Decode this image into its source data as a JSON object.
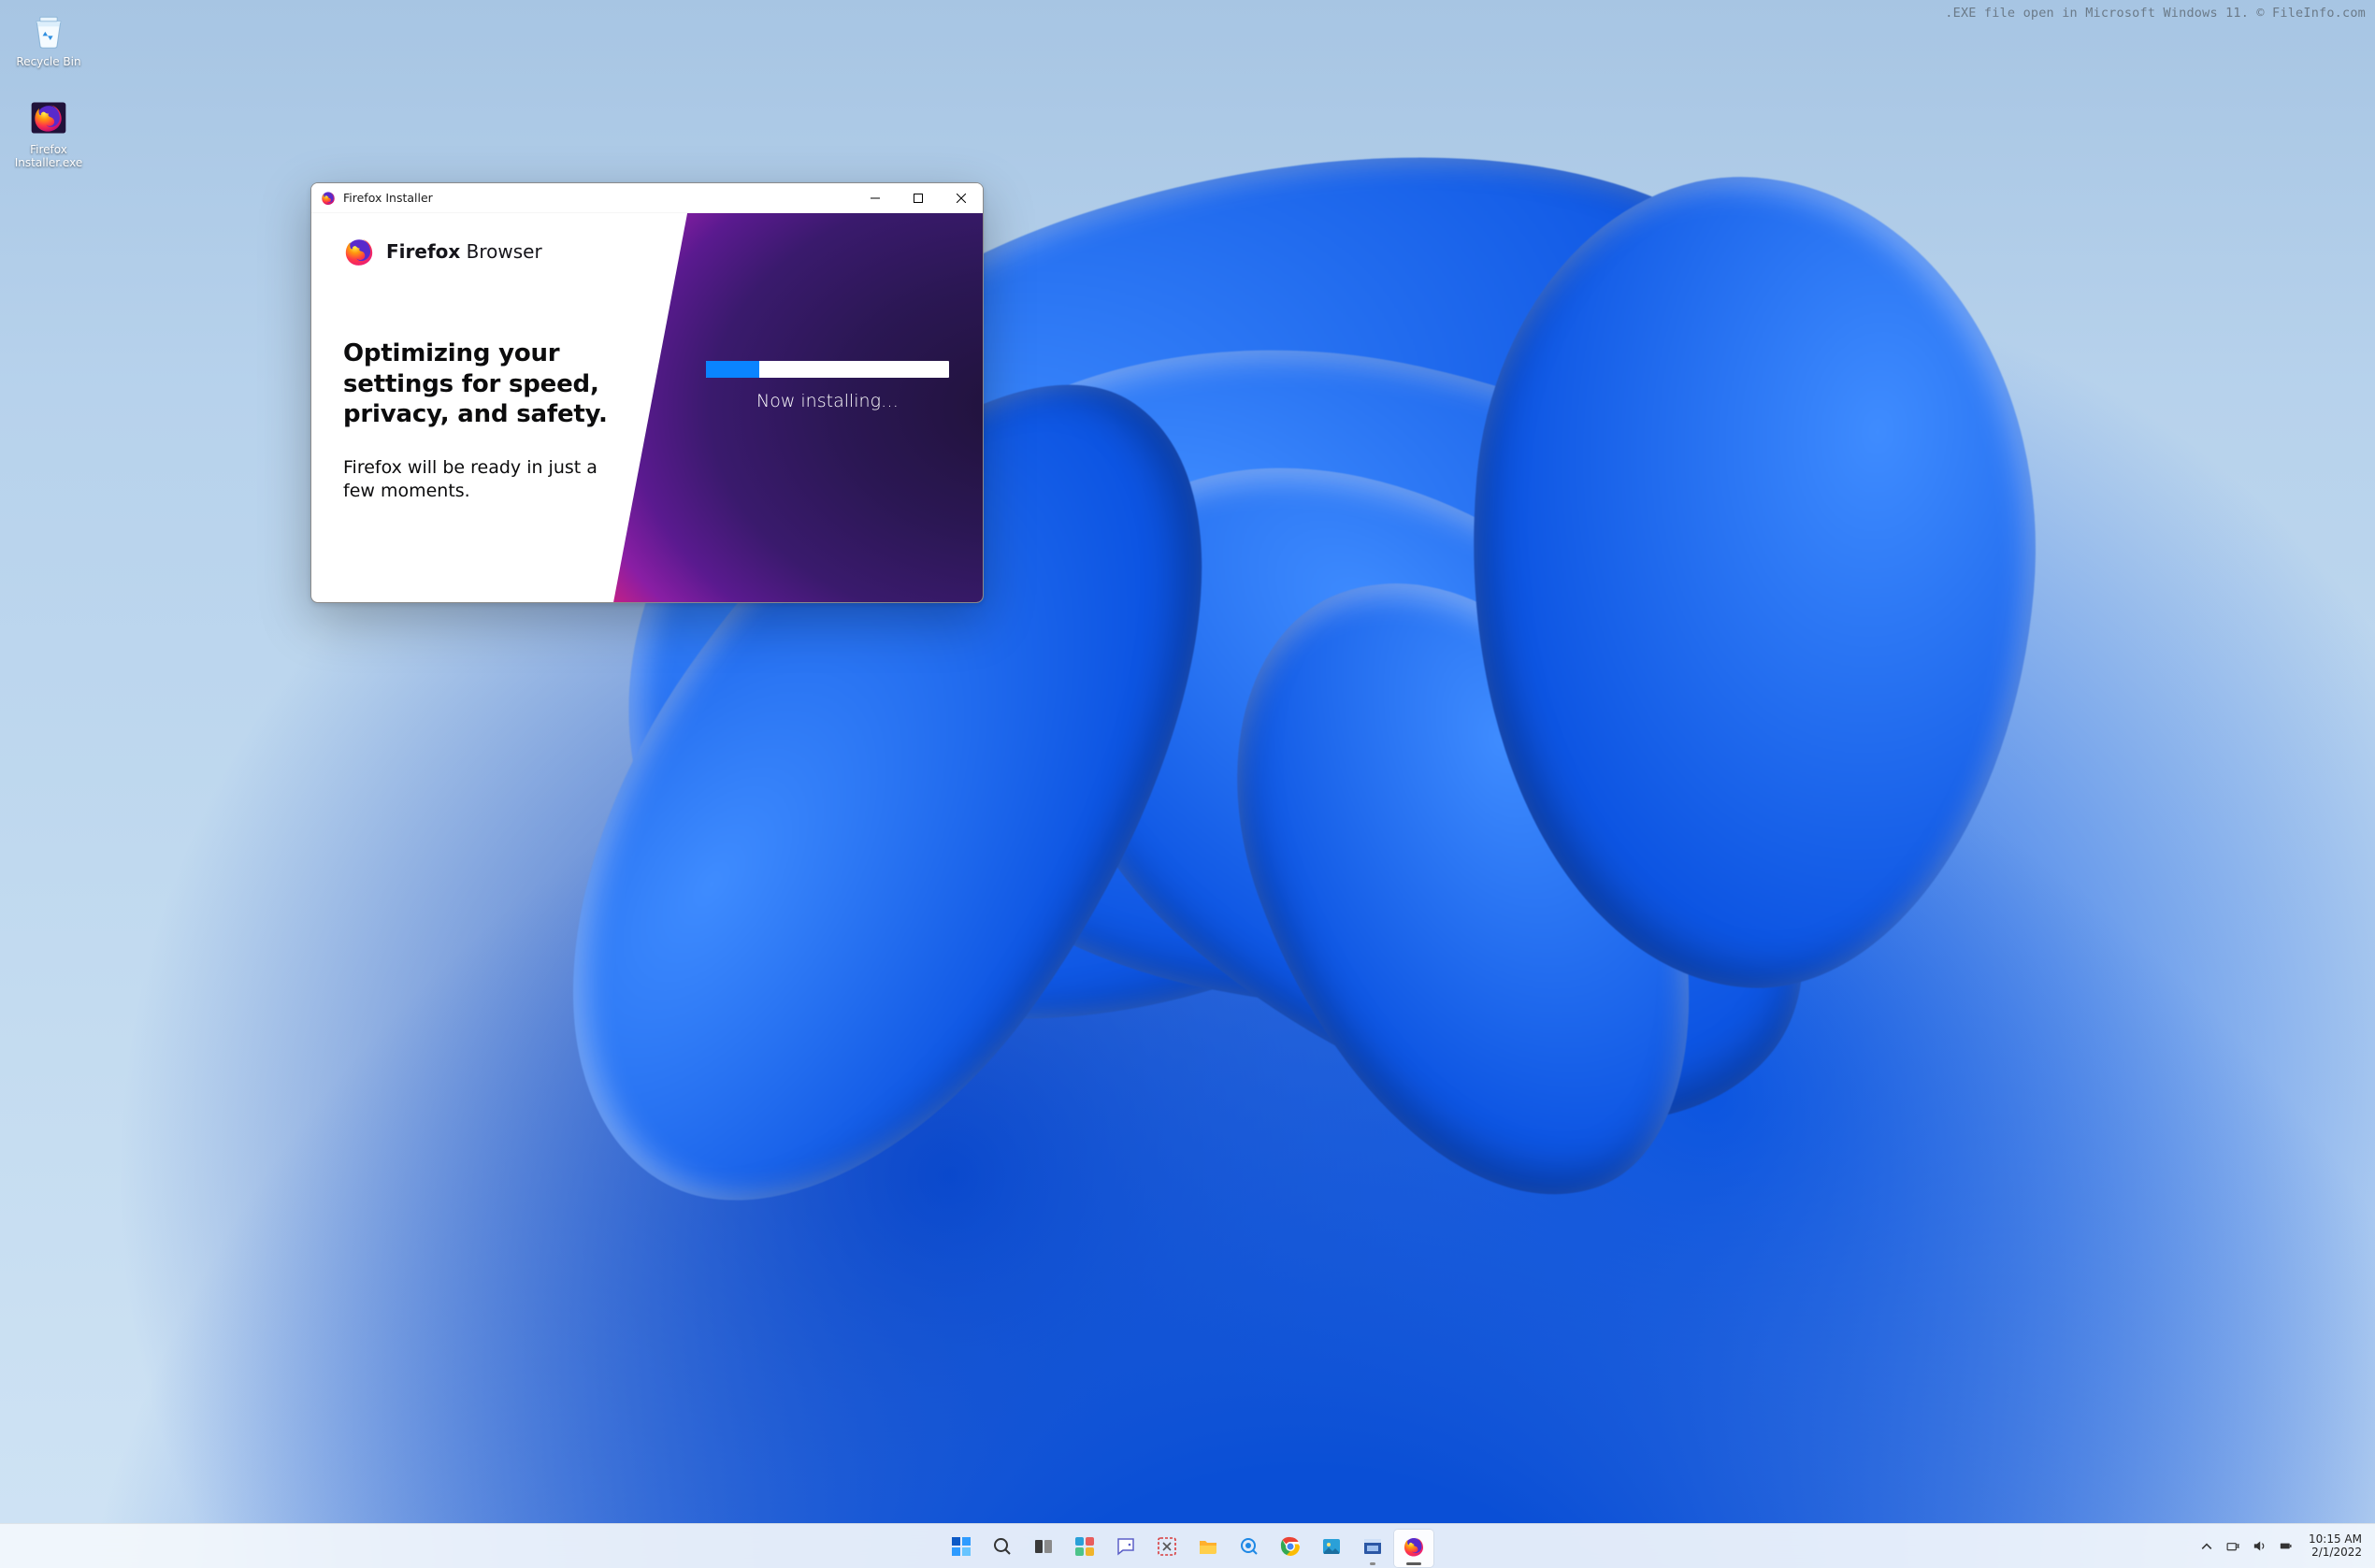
{
  "watermark": ".EXE file open in Microsoft Windows 11. © FileInfo.com",
  "desktop_icons": [
    {
      "name": "recycle-bin",
      "label": "Recycle Bin"
    },
    {
      "name": "firefox-installer-exe",
      "label": "Firefox Installer.exe"
    }
  ],
  "installer": {
    "title": "Firefox Installer",
    "brand_first": "Firefox",
    "brand_second": "Browser",
    "headline": "Optimizing your settings for speed, privacy, and safety.",
    "subtext": "Firefox will be ready in just a few moments.",
    "status": "Now installing…",
    "progress_percent": 22
  },
  "taskbar": {
    "items": [
      {
        "name": "start",
        "icon": "start-icon"
      },
      {
        "name": "search",
        "icon": "search-icon"
      },
      {
        "name": "task-view",
        "icon": "task-view-icon"
      },
      {
        "name": "widgets",
        "icon": "widgets-icon"
      },
      {
        "name": "chat",
        "icon": "chat-icon"
      },
      {
        "name": "snip",
        "icon": "snip-icon"
      },
      {
        "name": "file-explorer",
        "icon": "folder-icon"
      },
      {
        "name": "tips",
        "icon": "tips-icon"
      },
      {
        "name": "chrome",
        "icon": "chrome-icon"
      },
      {
        "name": "photos",
        "icon": "photos-icon"
      },
      {
        "name": "app-window",
        "icon": "app-window-icon",
        "state": "open"
      },
      {
        "name": "firefox-installer",
        "icon": "firefox-icon",
        "state": "active"
      }
    ]
  },
  "tray": {
    "time": "10:15 AM",
    "date": "2/1/2022"
  }
}
